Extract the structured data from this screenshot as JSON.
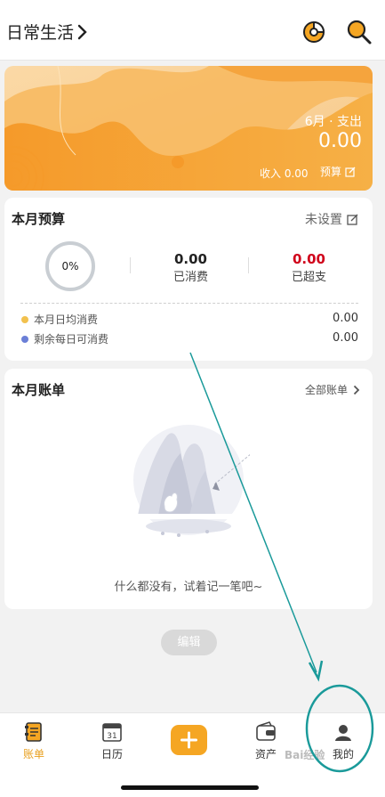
{
  "header": {
    "book_name": "日常生活",
    "chevron": "›"
  },
  "icons": {
    "stats": "pie-chart-icon",
    "search": "search-icon"
  },
  "banner": {
    "month": "6月",
    "dot": "·",
    "type": "支出",
    "amount": "0.00",
    "income_label": "收入",
    "income_value": "0.00",
    "budget_label": "预算"
  },
  "budget": {
    "title": "本月预算",
    "status": "未设置",
    "percent": "0%",
    "spent_value": "0.00",
    "spent_label": "已消费",
    "over_value": "0.00",
    "over_label": "已超支",
    "daily_avg_label": "本月日均消费",
    "daily_avg_value": "0.00",
    "remaining_label": "剩余每日可消费",
    "remaining_value": "0.00"
  },
  "bills": {
    "title": "本月账单",
    "all_link": "全部账单",
    "empty_text": "什么都没有，试着记一笔吧~"
  },
  "edit_button": "编辑",
  "nav": {
    "items": [
      {
        "label": "账单",
        "icon": "ledger-icon"
      },
      {
        "label": "日历",
        "icon": "calendar-icon",
        "badge": "31"
      },
      {
        "label": "",
        "icon": "plus-icon"
      },
      {
        "label": "资产",
        "icon": "wallet-icon"
      },
      {
        "label": "我的",
        "icon": "profile-icon"
      }
    ]
  },
  "watermark": "Bai经验",
  "colors": {
    "accent": "#f5a623",
    "over": "#d0021b",
    "annotation": "#1a9a9a"
  }
}
